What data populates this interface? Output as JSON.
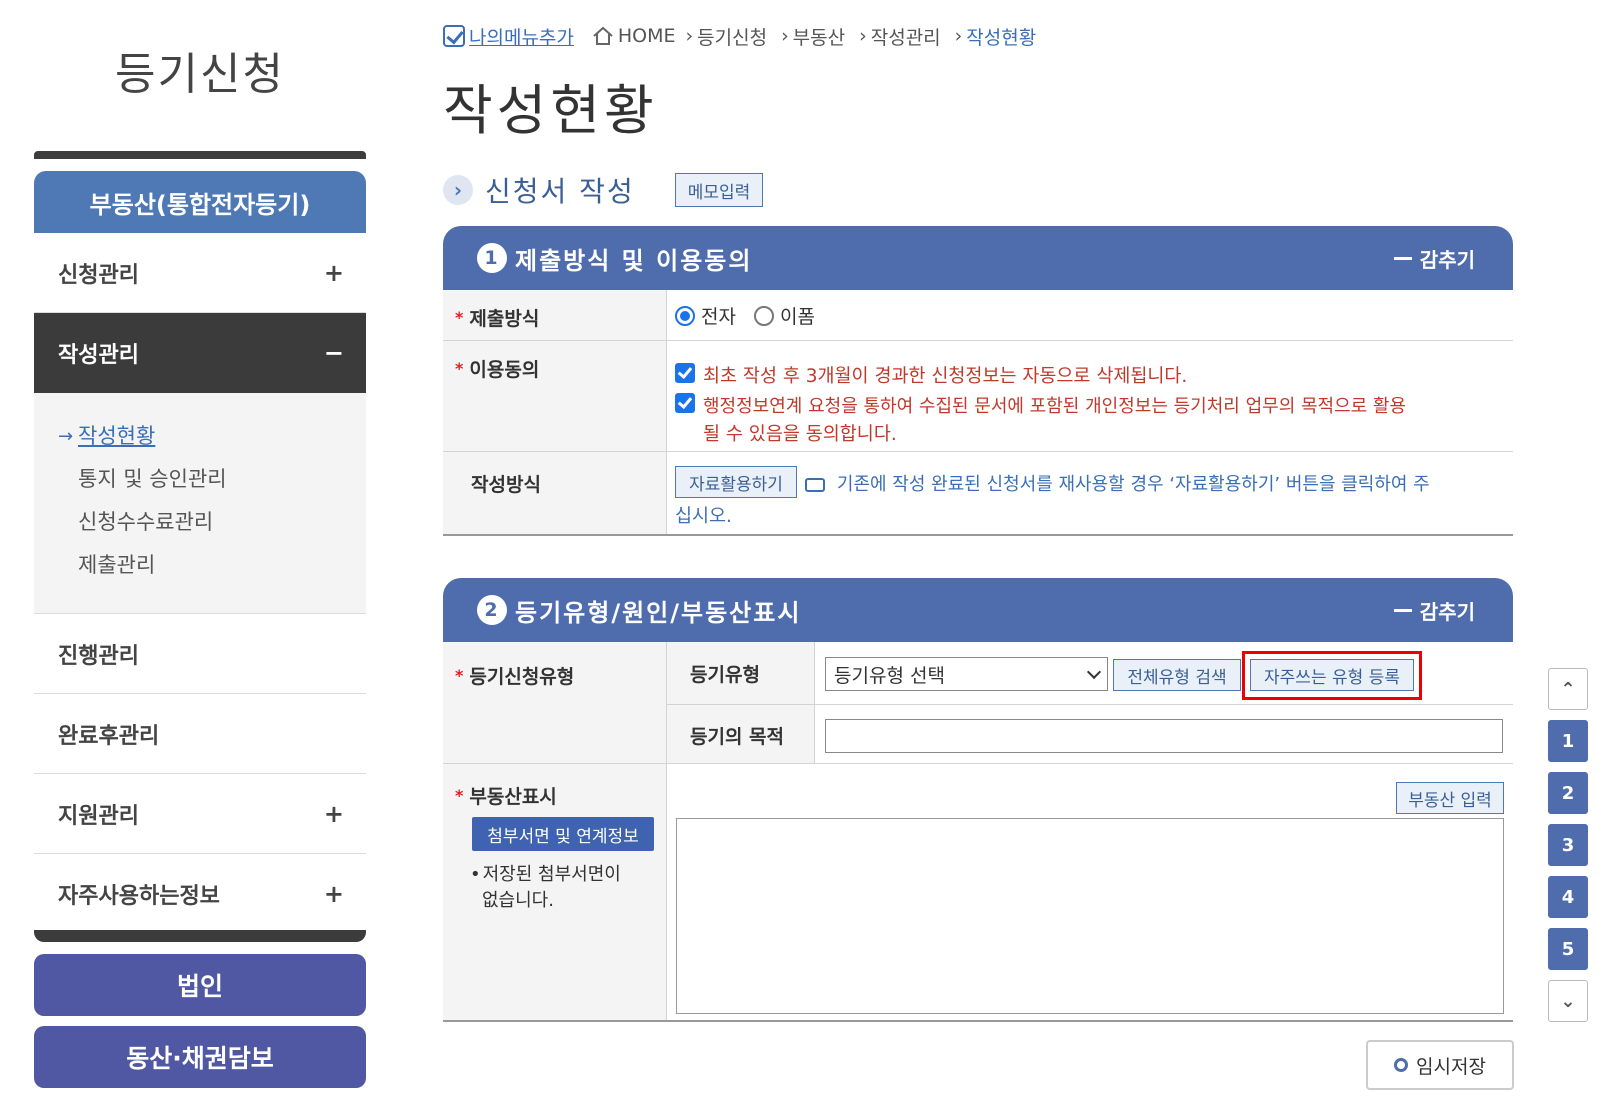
{
  "sidebar": {
    "title": "등기신청",
    "main_menu": "부동산(통합전자등기)",
    "items": [
      {
        "label": "신청관리",
        "sign": "+"
      },
      {
        "label": "작성관리",
        "sign": "−"
      },
      {
        "label": "진행관리",
        "sign": ""
      },
      {
        "label": "완료후관리",
        "sign": ""
      },
      {
        "label": "지원관리",
        "sign": "+"
      },
      {
        "label": "자주사용하는정보",
        "sign": "+"
      }
    ],
    "subitems": [
      "작성현황",
      "통지 및 승인관리",
      "신청수수료관리",
      "제출관리"
    ],
    "subitem_arrow": "→",
    "bottom_buttons": [
      "법인",
      "동산·채권담보"
    ]
  },
  "breadcrumb": {
    "my_menu": "나의메뉴추가",
    "items": [
      "HOME",
      "등기신청",
      "부동산",
      "작성관리",
      "작성현황"
    ],
    "separator": "›"
  },
  "page_title": "작성현황",
  "section": {
    "icon": "›",
    "title": "신청서 작성",
    "memo_button": "메모입력"
  },
  "panel1": {
    "number": "1",
    "title": "제출방식 및 이용동의",
    "collapse": "감추기",
    "submit_method": {
      "label": "제출방식",
      "required_mark": "*",
      "options": [
        "전자",
        "이폼"
      ],
      "selected": "전자"
    },
    "consent": {
      "label": "이용동의",
      "required_mark": "*",
      "line1": "최초 작성 후 3개월이 경과한 신청정보는 자동으로 삭제됩니다.",
      "line2a": "행정정보연계 요청을 통하여 수집된 문서에 포함된 개인정보는 등기처리 업무의 목적으로 활용",
      "line2b": "될 수 있음을 동의합니다."
    },
    "write_method": {
      "label": "작성방식",
      "button": "자료활용하기",
      "info_a": "기존에 작성 완료된 신청서를 재사용할 경우 ‘자료활용하기’ 버튼을 클릭하여 주",
      "info_b": "십시오."
    }
  },
  "panel2": {
    "number": "2",
    "title": "등기유형/원인/부동산표시",
    "collapse": "감추기",
    "apply_type": {
      "label": "등기신청유형",
      "required_mark": "*",
      "type_label": "등기유형",
      "select_value": "등기유형 선택",
      "search_button": "전체유형 검색",
      "register_button": "자주쓰는 유형 등록",
      "purpose_label": "등기의 목적",
      "purpose_value": ""
    },
    "property": {
      "label": "부동산표시",
      "required_mark": "*",
      "attach_button": "첨부서면 및 연계정보",
      "note_bullet": "•",
      "note_a": "저장된 첨부서면이",
      "note_b": "없습니다.",
      "input_button": "부동산 입력"
    }
  },
  "floating_nav": {
    "up": "⌃",
    "items": [
      "1",
      "2",
      "3",
      "4",
      "5"
    ],
    "down": "⌄"
  },
  "temp_save": "임시저장",
  "colors": {
    "panel_header": "#4f6cad",
    "sidebar_main": "#4f79b5",
    "sidebar_button": "#5058a3",
    "link_blue": "#3a6fb8",
    "warning_red": "#c0392b",
    "highlight": "#ee0000"
  }
}
